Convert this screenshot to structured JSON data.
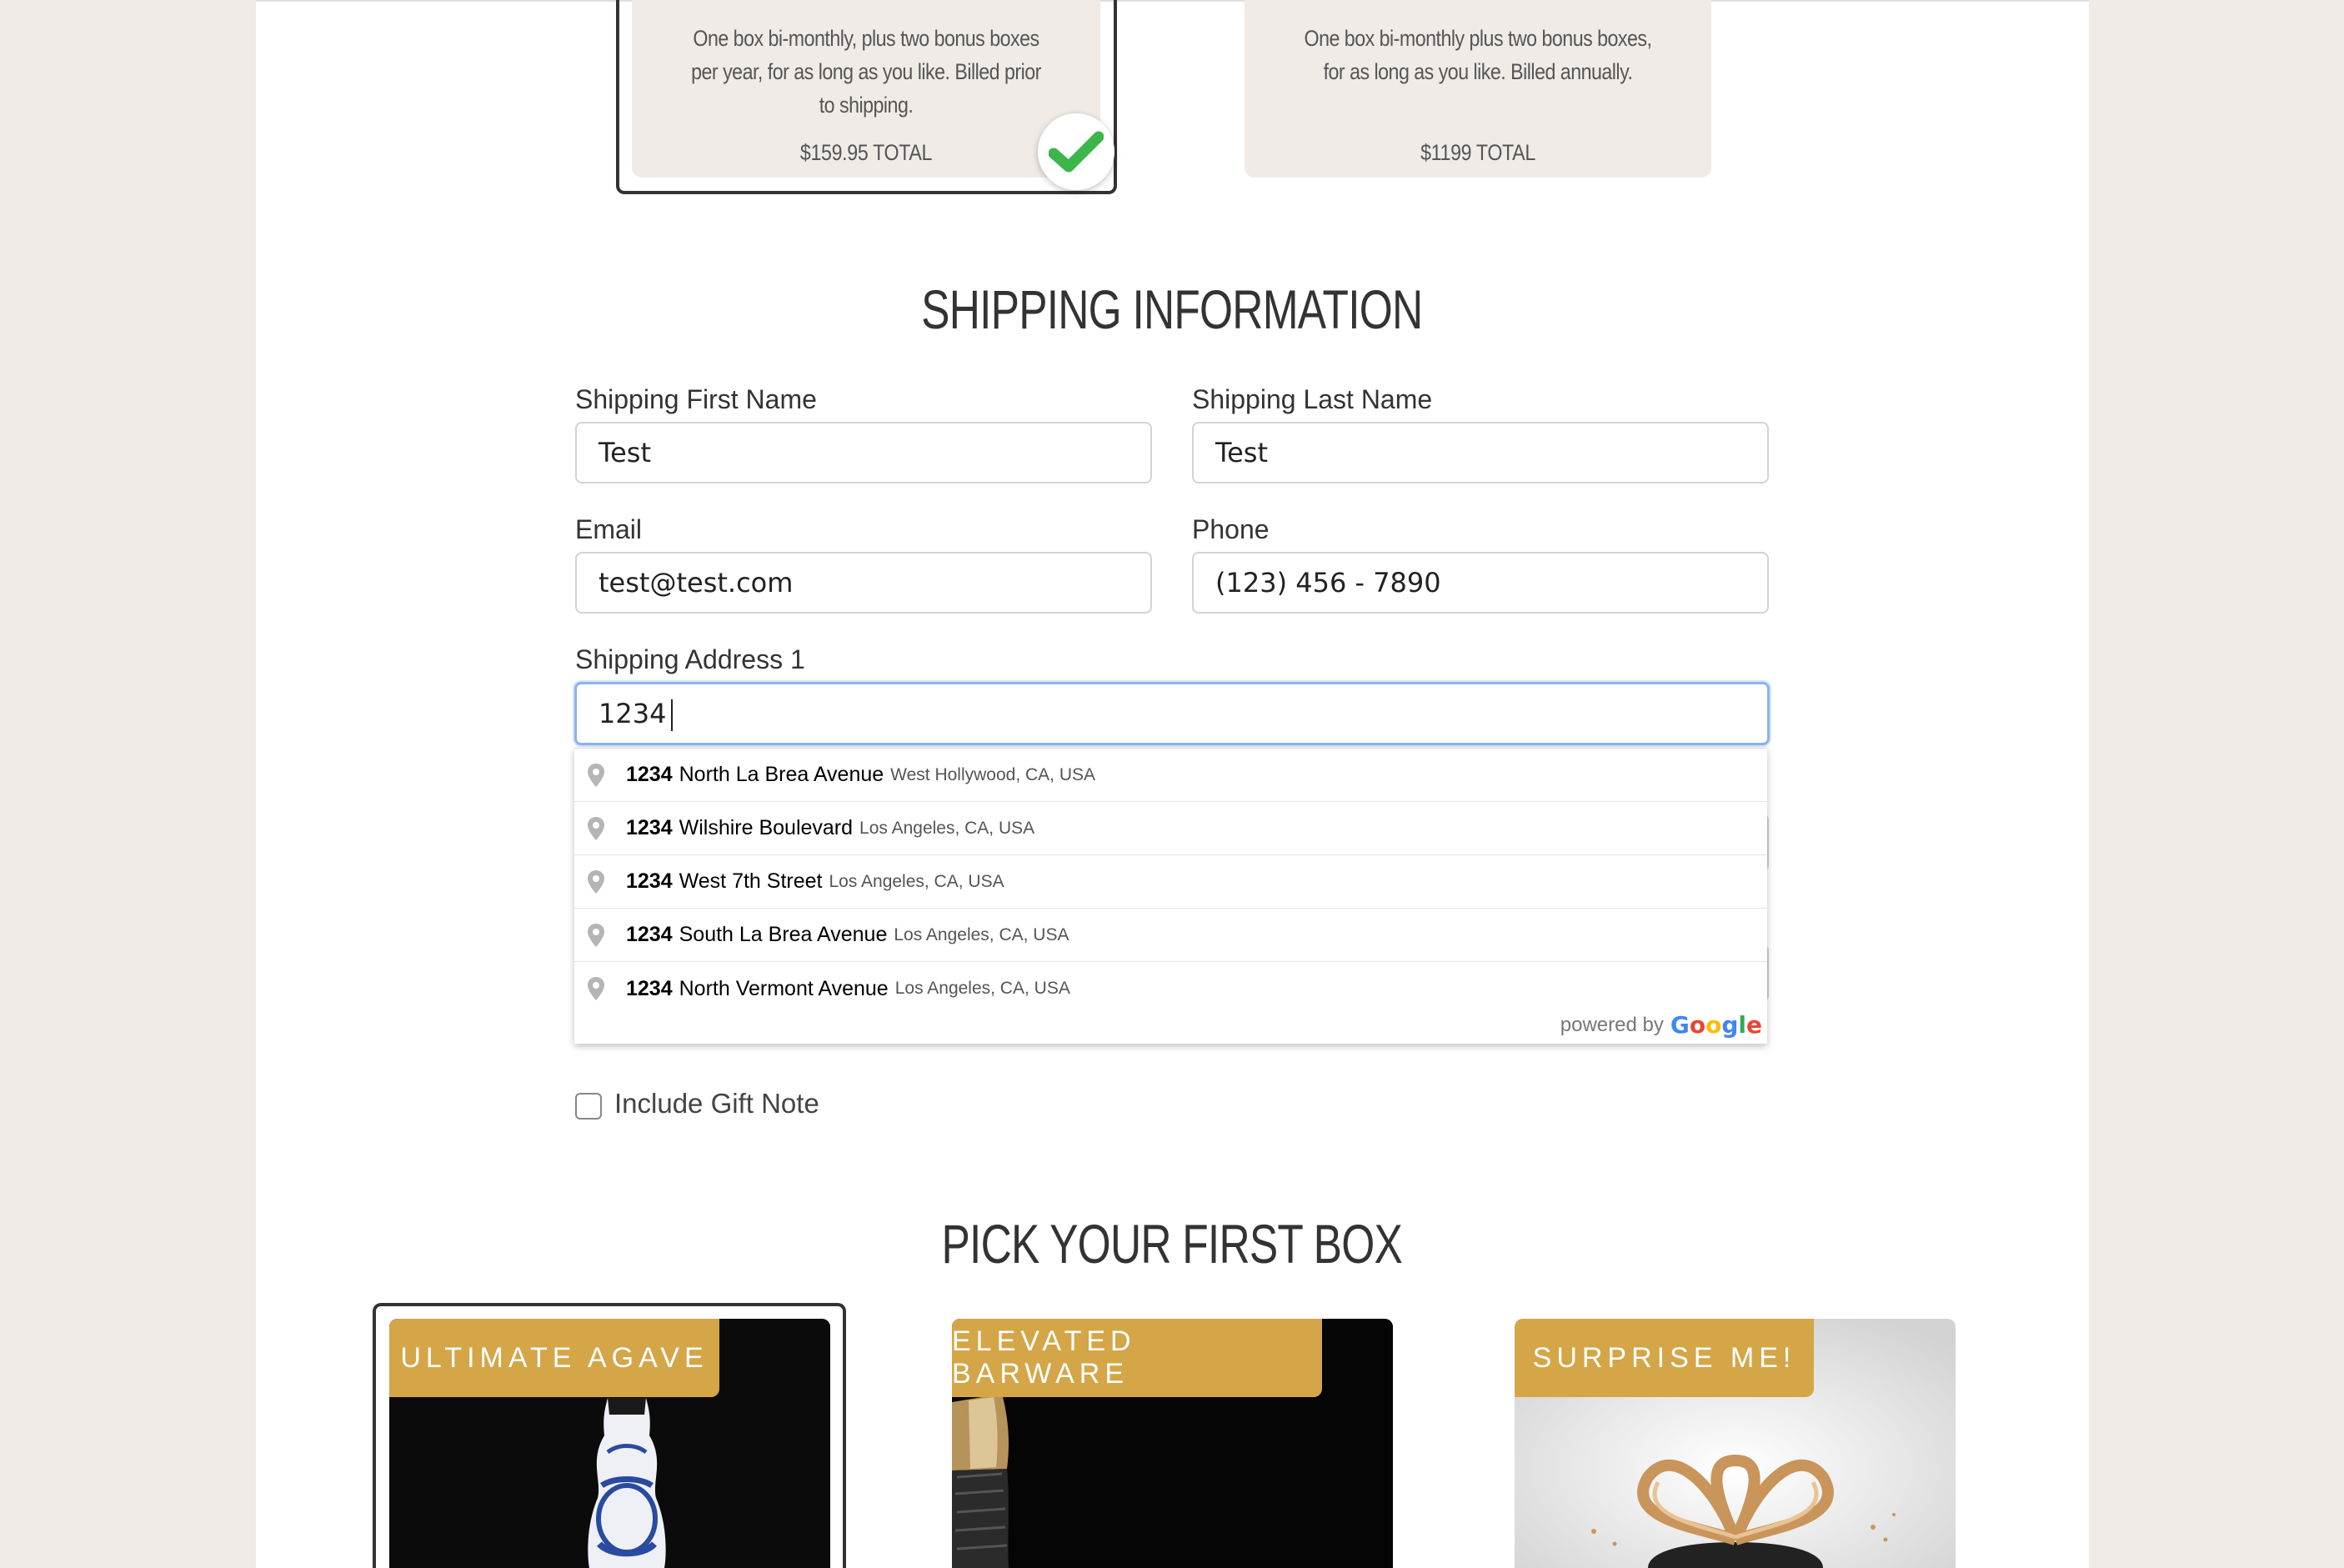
{
  "plans": [
    {
      "description": "One box bi-monthly, plus two bonus boxes per year, for as long as you like. Billed prior to shipping.",
      "total": "$159.95 TOTAL",
      "selected": true
    },
    {
      "description": "One box bi-monthly plus two bonus boxes, for as long as you like. Billed annually.",
      "total": "$1199 TOTAL",
      "selected": false
    }
  ],
  "shipping": {
    "heading": "SHIPPING INFORMATION",
    "first_name_label": "Shipping First Name",
    "first_name_value": "Test",
    "last_name_label": "Shipping Last Name",
    "last_name_value": "Test",
    "email_label": "Email",
    "email_value": "test@test.com",
    "phone_label": "Phone",
    "phone_value": "(123) 456 - 7890",
    "address1_label": "Shipping Address 1",
    "address1_value": "1234"
  },
  "autocomplete": {
    "suggestions": [
      {
        "number": "1234",
        "street": "North La Brea Avenue",
        "city": "West Hollywood, CA, USA"
      },
      {
        "number": "1234",
        "street": "Wilshire Boulevard",
        "city": "Los Angeles, CA, USA"
      },
      {
        "number": "1234",
        "street": "West 7th Street",
        "city": "Los Angeles, CA, USA"
      },
      {
        "number": "1234",
        "street": "South La Brea Avenue",
        "city": "Los Angeles, CA, USA"
      },
      {
        "number": "1234",
        "street": "North Vermont Avenue",
        "city": "Los Angeles, CA, USA"
      }
    ],
    "powered_by": "powered by",
    "google": [
      "G",
      "o",
      "o",
      "g",
      "l",
      "e"
    ],
    "google_colors": [
      "#4285F4",
      "#EA4335",
      "#FBBC05",
      "#4285F4",
      "#34A853",
      "#EA4335"
    ]
  },
  "gift_note": {
    "label": "Include Gift Note",
    "checked": false
  },
  "boxes": {
    "heading": "PICK YOUR FIRST BOX",
    "items": [
      {
        "label": "ULTIMATE AGAVE",
        "selected": true
      },
      {
        "label": "ELEVATED BARWARE",
        "selected": false
      },
      {
        "label": "SURPRISE ME!",
        "selected": false
      }
    ]
  },
  "colors": {
    "accent_gold": "#d4a647",
    "check_green": "#3cb54a",
    "focus_blue": "#8ab4f0"
  }
}
